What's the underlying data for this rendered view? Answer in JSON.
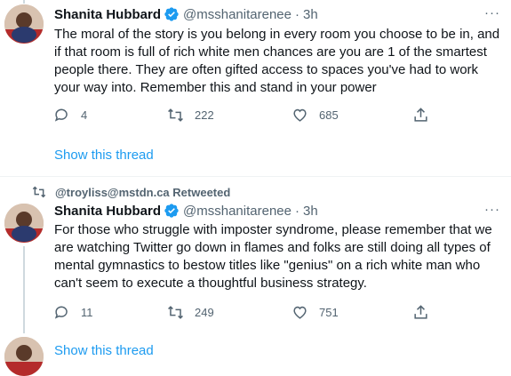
{
  "tweets": [
    {
      "name": "Shanita Hubbard",
      "handle": "@msshanitarenee",
      "sep": "·",
      "time": "3h",
      "text": "The moral of the story is you belong in every room you choose to be in, and if that room is full of rich white men chances are you are 1 of the smartest people there. They are often gifted access to spaces you've had to work your way into. Remember this and stand in your power",
      "replies": "4",
      "retweets": "222",
      "likes": "685",
      "show_thread": "Show this thread"
    },
    {
      "retweet_label": "@troyliss@mstdn.ca Retweeted",
      "name": "Shanita Hubbard",
      "handle": "@msshanitarenee",
      "sep": "·",
      "time": "3h",
      "text": "For those who struggle with imposter syndrome, please remember that we are watching Twitter go down in flames and folks are still doing all types of mental gymnastics to bestow titles like \"genius\" on a rich white man who can't seem to execute a thoughtful business strategy.",
      "replies": "11",
      "retweets": "249",
      "likes": "751",
      "show_thread": "Show this thread"
    }
  ],
  "more_glyph": "···",
  "icons": {
    "reply": "reply-icon",
    "retweet": "retweet-icon",
    "like": "heart-icon",
    "share": "share-icon",
    "verified": "verified-badge-icon"
  },
  "colors": {
    "accent": "#1d9bf0",
    "muted": "#536471",
    "text": "#0f1419"
  }
}
